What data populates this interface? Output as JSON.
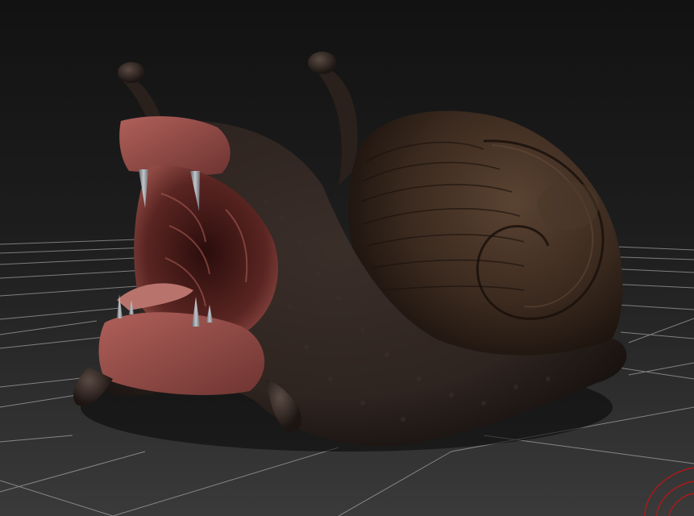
{
  "viewport": {
    "background_top": "#121212",
    "background_mid": "#1d1d1d",
    "background_bottom": "#3a3a3a",
    "grid_color": "#c9c9c9",
    "gizmo_color": "#b01818"
  },
  "model": {
    "body_color": "#2e2420",
    "body_shadow": "#120d0b",
    "shell_color": "#3b2a1f",
    "shell_highlight": "#5a4332",
    "mouth_color": "#8f4a44",
    "mouth_dark": "#2a0d0c",
    "lip_color": "#9a4f48",
    "tooth_color": "#8e9196",
    "tentacle_color": "#2a201c"
  },
  "icons": {
    "rotation_gizmo": "rotation-gizmo-icon"
  }
}
